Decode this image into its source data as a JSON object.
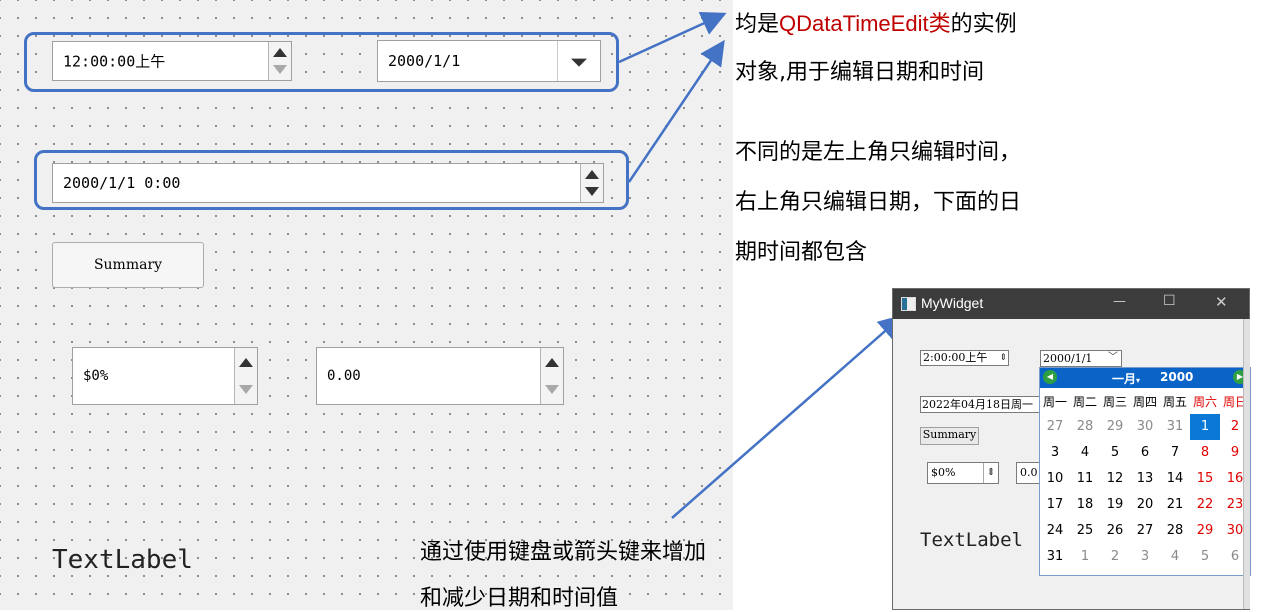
{
  "designer": {
    "time_edit_value": "12:00:00上午",
    "date_edit_value": "2000/1/1",
    "datetime_edit_value": "2000/1/1 0:00",
    "summary_button_label": "Summary",
    "spin_percent_value": "$0%",
    "spin_double_value": "0.00",
    "text_label": "TextLabel"
  },
  "annotations": {
    "top_line1_a": "均是",
    "top_line1_red": "QDataTimeEdit类",
    "top_line1_b": "的实例",
    "top_line2": "对象,用于编辑日期和时间",
    "mid_line1": "不同的是左上角只编辑时间，",
    "mid_line2": "右上角只编辑日期，下面的日",
    "mid_line3": "期时间都包含",
    "bottom_line1": "通过使用键盘或箭头键来增加",
    "bottom_line2": "和减少日期和时间值"
  },
  "window": {
    "title": "MyWidget",
    "minimize_symbol": "—",
    "maximize_symbol": "☐",
    "close_symbol": "✕",
    "time_value": "2:00:00上午",
    "date_value": "2000/1/1",
    "datetime_value": "2022年04月18日周一",
    "summary_label": "Summary",
    "percent_value": "$0%",
    "double_value_partial": "0.0",
    "text_label": "TextLabel"
  },
  "calendar": {
    "month_label": "一月",
    "year_label": "2000",
    "prev_symbol": "◀",
    "next_symbol": "▶",
    "weekdays": [
      "周一",
      "周二",
      "周三",
      "周四",
      "周五",
      "周六",
      "周日"
    ],
    "weeks": [
      [
        "27",
        "28",
        "29",
        "30",
        "31",
        "1",
        "2"
      ],
      [
        "3",
        "4",
        "5",
        "6",
        "7",
        "8",
        "9"
      ],
      [
        "10",
        "11",
        "12",
        "13",
        "14",
        "15",
        "16"
      ],
      [
        "17",
        "18",
        "19",
        "20",
        "21",
        "22",
        "23"
      ],
      [
        "24",
        "25",
        "26",
        "27",
        "28",
        "29",
        "30"
      ],
      [
        "31",
        "1",
        "2",
        "3",
        "4",
        "5",
        "6"
      ]
    ],
    "selected_day": "1",
    "colors": {
      "header_bg": "#0a64c8",
      "weekend": "#e00000",
      "other_month": "#8a8a8a",
      "selected_bg": "#0a78d7"
    }
  },
  "colors": {
    "highlight_border": "#4472c4",
    "annotation_red": "#c00000"
  }
}
